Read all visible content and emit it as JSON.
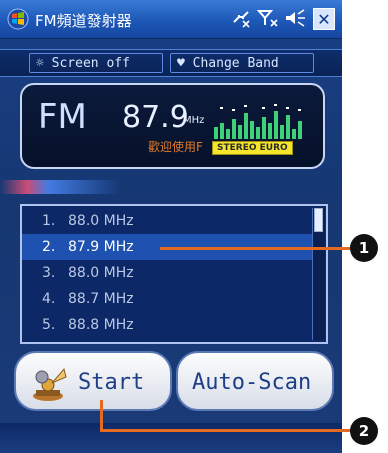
{
  "app": {
    "title": "FM頻道發射器",
    "close_label": "✕"
  },
  "status_icons": [
    "connectivity-icon",
    "signal-off-icon",
    "volume-muted-icon"
  ],
  "toolbar": {
    "screen_off_label": "☼ Screen off",
    "change_band_label": "♥ Change Band"
  },
  "display": {
    "band": "FM",
    "frequency": "87.9",
    "unit": "MHz",
    "station_label": "歡迎使用F",
    "mode_badge": "STEREO EURO"
  },
  "channel_list": {
    "items": [
      {
        "num": "1.",
        "freq": "88.0 MHz"
      },
      {
        "num": "2.",
        "freq": "87.9 MHz"
      },
      {
        "num": "3.",
        "freq": "88.0 MHz"
      },
      {
        "num": "4.",
        "freq": "88.7 MHz"
      },
      {
        "num": "5.",
        "freq": "88.8 MHz"
      }
    ],
    "selected_index": 1
  },
  "buttons": {
    "start_label": "Start",
    "auto_scan_label": "Auto-Scan"
  },
  "callouts": {
    "one": "1",
    "two": "2"
  },
  "colors": {
    "accent": "#e46a1f",
    "selection": "#1f52b0",
    "badge": "#f5e62b"
  }
}
